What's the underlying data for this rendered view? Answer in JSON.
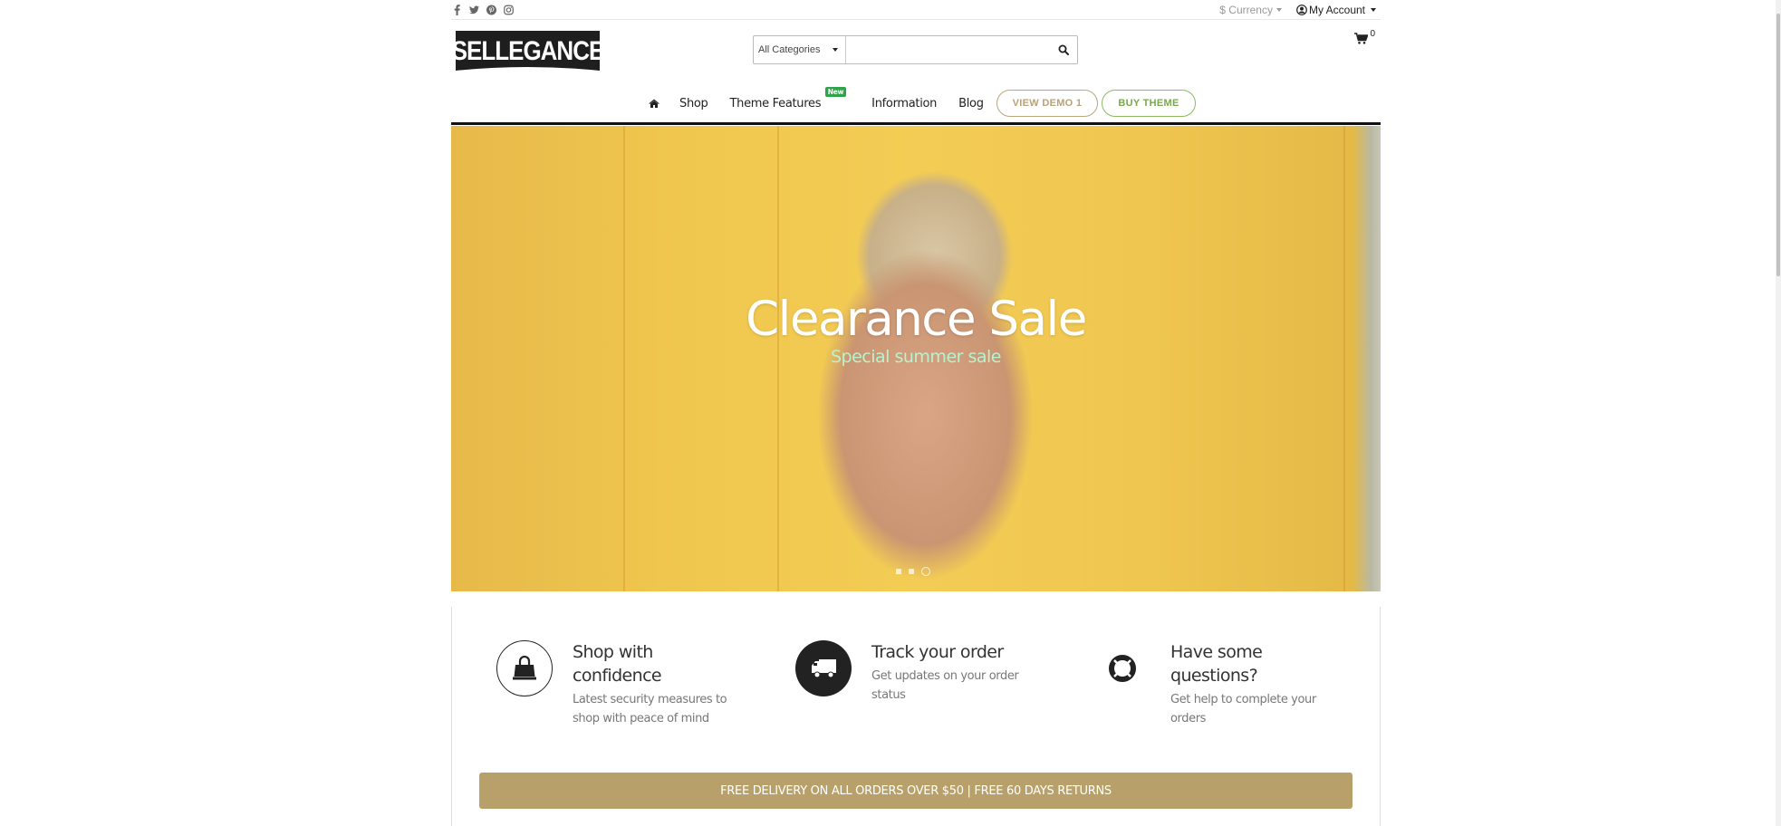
{
  "topbar": {
    "social": [
      {
        "name": "facebook-icon",
        "glyph": "f"
      },
      {
        "name": "twitter-icon",
        "glyph": "twitter"
      },
      {
        "name": "pinterest-icon",
        "glyph": "pinterest"
      },
      {
        "name": "instagram-icon",
        "glyph": "instagram"
      }
    ],
    "currency_label": "$ Currency",
    "account_label": "My Account"
  },
  "header": {
    "logo_text": "SELLEGANCE",
    "search": {
      "category": "All Categories",
      "value": "",
      "placeholder": ""
    },
    "cart_count": "0"
  },
  "nav": {
    "items": [
      {
        "label": "Shop"
      },
      {
        "label": "Theme Features",
        "badge": "New"
      },
      {
        "label": "Information"
      },
      {
        "label": "Blog"
      }
    ],
    "demo_button": "VIEW DEMO 1",
    "buy_button": "BUY THEME"
  },
  "hero": {
    "title": "Clearance Sale",
    "subtitle": "Special summer sale",
    "slides_total": 3,
    "active_slide": 3
  },
  "features": [
    {
      "icon": "shopping-bag-icon",
      "title_lines": [
        "Shop with",
        "confidence"
      ],
      "desc_lines": [
        "Latest security measures to",
        "shop with peace of mind"
      ]
    },
    {
      "icon": "truck-icon",
      "title_lines": [
        "Track your order"
      ],
      "desc_lines": [
        "Get updates on your order",
        "status"
      ]
    },
    {
      "icon": "life-ring-icon",
      "title_lines": [
        "Have some",
        "questions?"
      ],
      "desc_lines": [
        "Get help to complete your",
        "orders"
      ]
    }
  ],
  "promo_banner": "FREE DELIVERY ON ALL ORDERS OVER $50 | FREE 60 DAYS RETURNS",
  "colors": {
    "accent_gold": "#b8a06a",
    "new_badge": "#2ea34a",
    "buy_green": "#7aa84e",
    "hero_subtitle": "#b9f2cf"
  }
}
